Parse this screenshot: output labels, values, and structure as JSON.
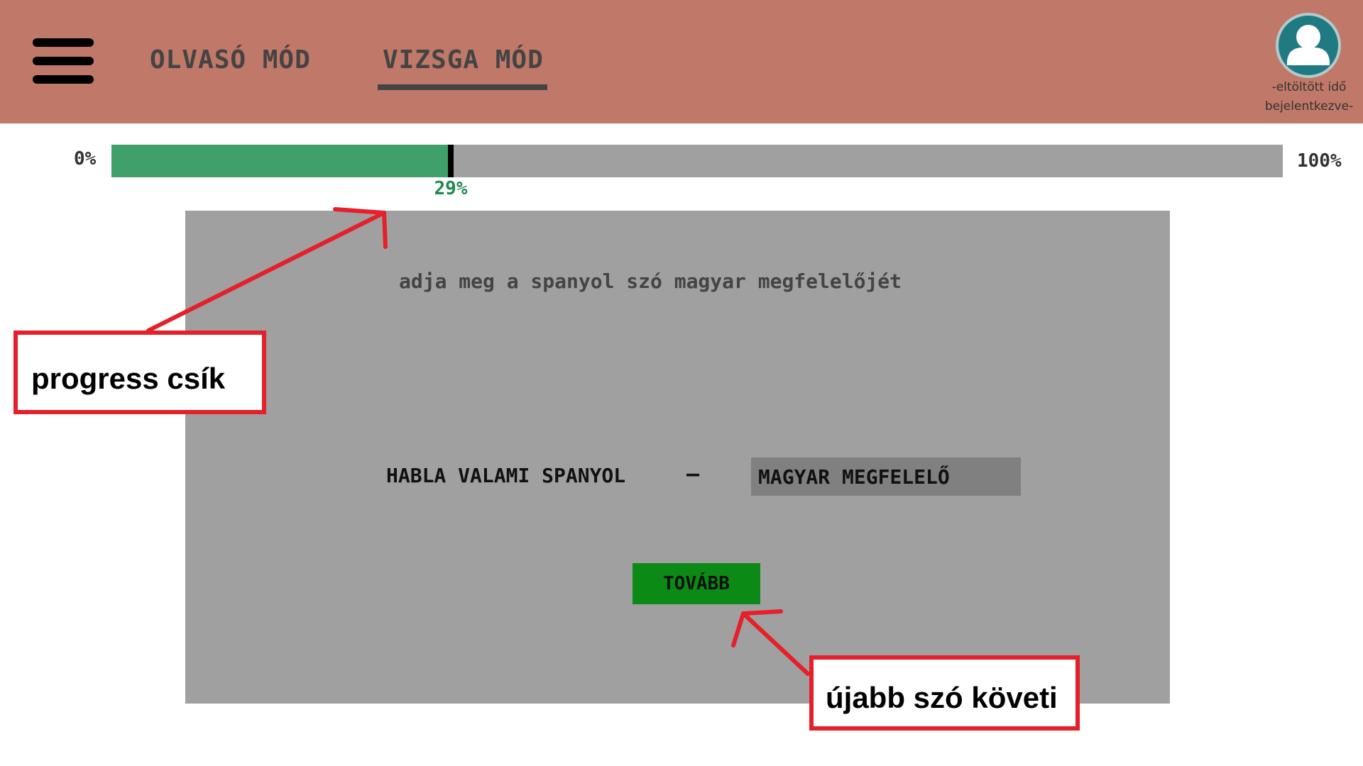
{
  "header": {
    "menu_icon": "hamburger-menu-icon",
    "tabs": [
      {
        "label": "OLVASÓ MÓD",
        "active": false
      },
      {
        "label": "VIZSGA MÓD",
        "active": true
      }
    ],
    "user": {
      "avatar_icon": "user-avatar-icon",
      "time_spent": "-eltöltött idő",
      "status": "bejelentkezve-"
    },
    "colors": {
      "background": "#c07868",
      "tab_text": "#444444"
    }
  },
  "progress": {
    "start_label": "0%",
    "end_label": "100%",
    "value_label": "29%",
    "value": 0.29,
    "colors": {
      "fill": "#40a06a",
      "track": "#a0a0a0",
      "label": "#1e8a4e"
    }
  },
  "exercise": {
    "instruction": "adja meg a spanyol szó magyar megfelelőjét",
    "source_word": "HABLA VALAMI SPANYOL",
    "separator": "–",
    "answer_placeholder": "MAGYAR MEGFELELŐ",
    "next_label": "TOVÁBB",
    "colors": {
      "card": "#a0a0a0",
      "input": "#808080",
      "button": "#0b8a16"
    }
  },
  "annotations": {
    "progress_callout": "progress csík",
    "next_callout": "újabb szó követi",
    "color": "#e5202a"
  }
}
